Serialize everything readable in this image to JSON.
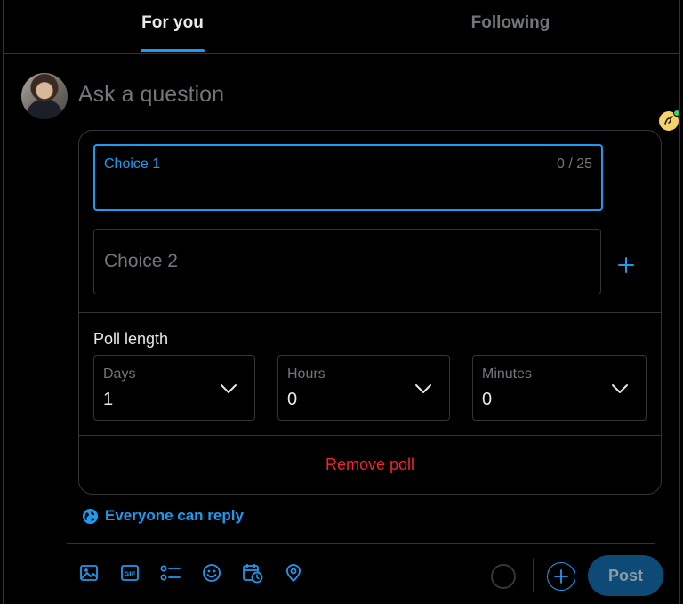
{
  "tabs": [
    {
      "label": "For you",
      "active": true
    },
    {
      "label": "Following",
      "active": false
    }
  ],
  "composer": {
    "placeholder": "Ask a question"
  },
  "poll": {
    "choices": [
      {
        "label": "Choice 1",
        "counter": "0 / 25",
        "focused": true
      },
      {
        "label": "Choice 2",
        "focused": false
      }
    ],
    "poll_length_label": "Poll length",
    "days": {
      "label": "Days",
      "value": "1"
    },
    "hours": {
      "label": "Hours",
      "value": "0"
    },
    "minutes": {
      "label": "Minutes",
      "value": "0"
    },
    "remove_label": "Remove poll"
  },
  "reply_setting": {
    "label": "Everyone can reply",
    "icon": "globe-icon"
  },
  "toolbar": {
    "icons": [
      "image-icon",
      "gif-icon",
      "poll-icon",
      "emoji-icon",
      "schedule-icon",
      "location-icon"
    ],
    "post_label": "Post"
  },
  "colors": {
    "accent": "#1d9bf0",
    "danger": "#f4212e",
    "border": "#333639",
    "muted_text": "#71767b",
    "post_button_disabled": "#0d4a75"
  }
}
